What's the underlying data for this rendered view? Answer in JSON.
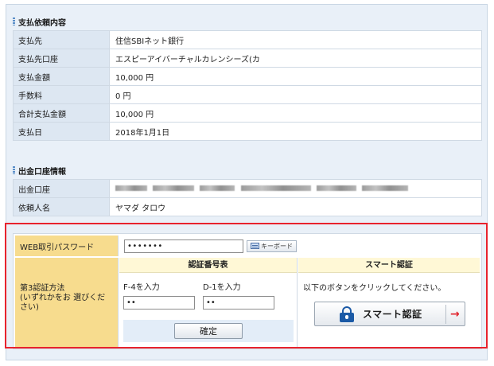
{
  "payment": {
    "section_title": "支払依頼内容",
    "rows": [
      {
        "label": "支払先",
        "value": "住信SBIネット銀行"
      },
      {
        "label": "支払先口座",
        "value": "エスピーアイバーチャルカレンシーズ(カ"
      },
      {
        "label": "支払金額",
        "value": "10,000 円"
      },
      {
        "label": "手数料",
        "value": "0 円"
      },
      {
        "label": "合計支払金額",
        "value": "10,000 円"
      },
      {
        "label": "支払日",
        "value": "2018年1月1日"
      }
    ]
  },
  "account": {
    "section_title": "出金口座情報",
    "rows": [
      {
        "label": "出金口座",
        "value": ""
      },
      {
        "label": "依頼人名",
        "value": "ヤマダ タロウ"
      }
    ]
  },
  "auth": {
    "password_label": "WEB取引パスワード",
    "password_value": "•••••••",
    "keyboard_button": "キーボード",
    "method_label": "第3認証方法\n(いずれかをお 選びください)",
    "code_table": {
      "header": "認証番号表",
      "field1_label": "F-4を入力",
      "field1_value": "••",
      "field2_label": "D-1を入力",
      "field2_value": "••",
      "confirm_button": "確定"
    },
    "smart": {
      "header": "スマート認証",
      "instruction": "以下のボタンをクリックしてください。",
      "button_label": "スマート認証"
    }
  },
  "colors": {
    "highlight_border": "#e8232d",
    "label_yellow": "#f7dc8e",
    "label_blue": "#dde7f2",
    "lock_blue": "#1b5aa6",
    "arrow_red": "#e0232b"
  }
}
